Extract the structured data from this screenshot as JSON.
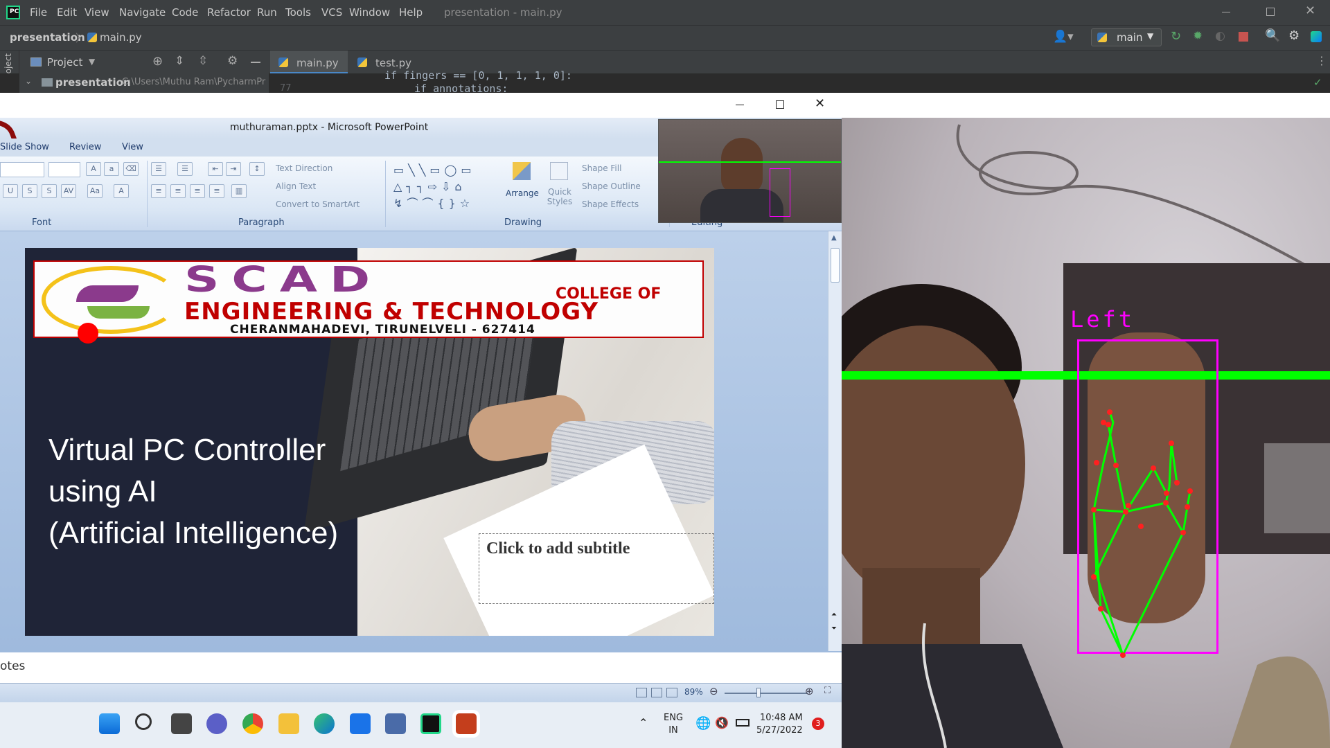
{
  "pycharm": {
    "window_title": "presentation - main.py",
    "menu": [
      "File",
      "Edit",
      "View",
      "Navigate",
      "Code",
      "Refactor",
      "Run",
      "Tools",
      "VCS",
      "Window",
      "Help"
    ],
    "breadcrumb_project": "presentation",
    "breadcrumb_file": "main.py",
    "run_config": "main",
    "project_label": "Project",
    "side_project_label": "Project",
    "tabs": [
      "main.py",
      "test.py"
    ],
    "tree_root": "presentation",
    "tree_path": "C:\\Users\\Muthu Ram\\PycharmPr",
    "code_line_1": "if fingers == [0, 1, 1, 1, 0]:",
    "code_line_2": "if annotations:",
    "gutter_num": "77",
    "accent": "#4a88c7"
  },
  "powerpoint": {
    "title": "muthuraman.pptx - Microsoft PowerPoint",
    "ribbon_tabs": [
      "Slide Show",
      "Review",
      "View"
    ],
    "groups": {
      "font": "Font",
      "paragraph": "Paragraph",
      "drawing": "Drawing",
      "editing": "Editing"
    },
    "paragraph_tools": [
      "Text Direction",
      "Align Text",
      "Convert to SmartArt"
    ],
    "drawing_tools": {
      "arrange": "Arrange",
      "quick_styles": "Quick Styles",
      "shape_fill": "Shape Fill",
      "shape_outline": "Shape Outline",
      "shape_effects": "Shape Effects"
    },
    "slide": {
      "logo_big": "SCAD",
      "logo_college": "COLLEGE OF",
      "logo_eng": "ENGINEERING & TECHNOLOGY",
      "logo_addr": "CHERANMAHADEVI, TIRUNELVELI - 627414",
      "title_line_1": "Virtual PC Controller",
      "title_line_2": "using AI",
      "title_line_3": "(Artificial Intelligence)",
      "subtitle_placeholder": "Click to add subtitle"
    },
    "notes_label": "otes",
    "zoom": "89%"
  },
  "taskbar": {
    "lang_1": "ENG",
    "lang_2": "IN",
    "time": "10:48 AM",
    "date": "5/27/2022",
    "badge": "3"
  },
  "webcam": {
    "hand_label": "Left",
    "line_color": "#00ff00",
    "box_color": "#ff00ff",
    "thumb_label": "Editing"
  }
}
